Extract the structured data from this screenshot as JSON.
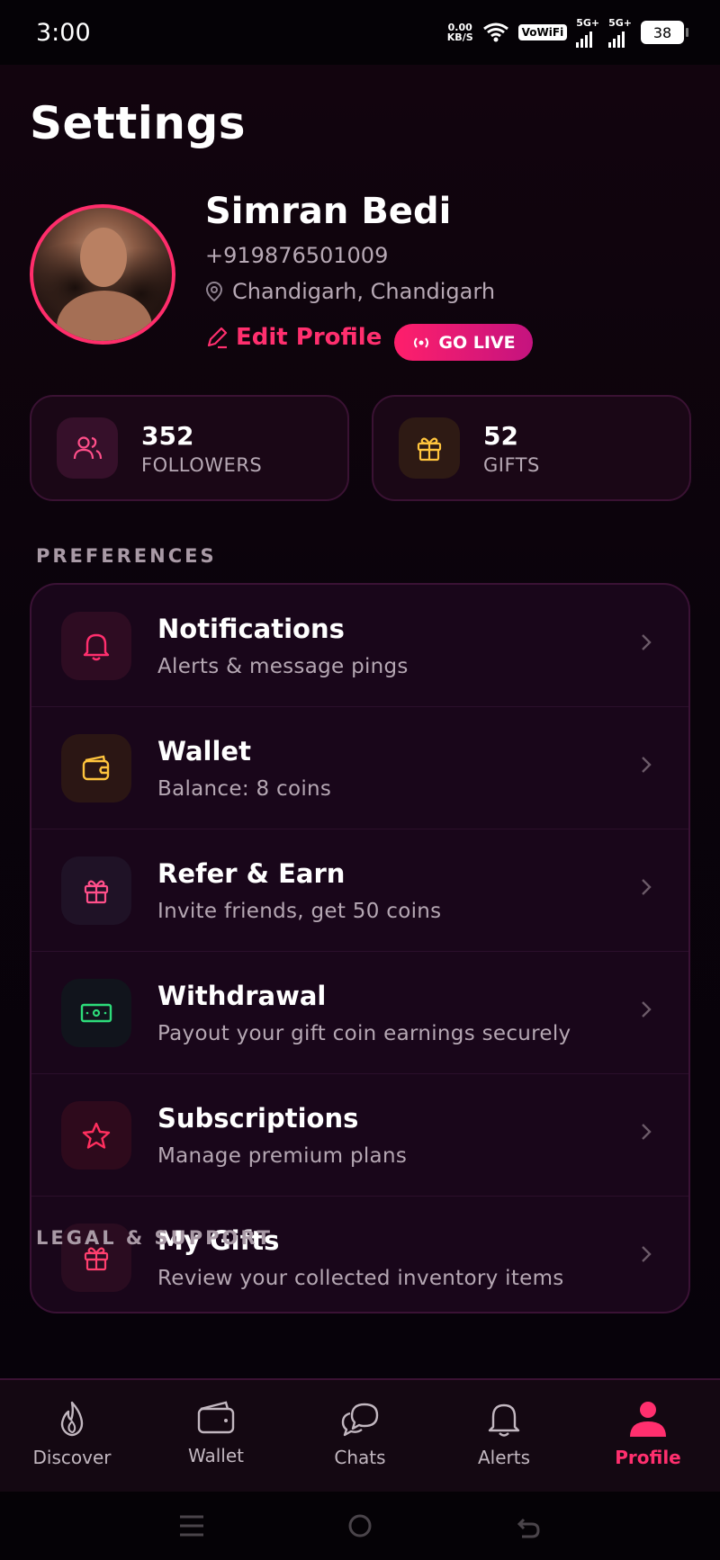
{
  "status_bar": {
    "time": "3:00",
    "net_speed_value": "0.00",
    "net_speed_unit": "KB/S",
    "vowifi": "VoWiFi",
    "sim1_label": "5G+",
    "sim2_label": "5G+",
    "battery": "38"
  },
  "header": {
    "title": "Settings"
  },
  "profile": {
    "name": "Simran Bedi",
    "phone": "+919876501009",
    "location": "Chandigarh, Chandigarh",
    "edit_label": "Edit Profile",
    "go_live_label": "GO LIVE"
  },
  "stats": [
    {
      "value": "352",
      "label": "FOLLOWERS",
      "icon": "users-icon"
    },
    {
      "value": "52",
      "label": "GIFTS",
      "icon": "gift-icon"
    }
  ],
  "preferences": {
    "section_title": "PREFERENCES",
    "items": [
      {
        "title": "Notifications",
        "subtitle": "Alerts & message pings",
        "icon": "bell-icon",
        "color": "#ff2f6e"
      },
      {
        "title": "Wallet",
        "subtitle": "Balance: 8 coins",
        "icon": "wallet-icon",
        "color": "#ffc43d"
      },
      {
        "title": "Refer & Earn",
        "subtitle": "Invite friends, get 50 coins",
        "icon": "gift-icon",
        "color": "#ff4f8a"
      },
      {
        "title": "Withdrawal",
        "subtitle": "Payout your gift coin earnings securely",
        "icon": "cash-icon",
        "color": "#2ddc7a"
      },
      {
        "title": "Subscriptions",
        "subtitle": "Manage premium plans",
        "icon": "star-icon",
        "color": "#ff2f5e"
      },
      {
        "title": "My Gifts",
        "subtitle": "Review your collected inventory items",
        "icon": "gift-icon",
        "color": "#ff3f6e"
      }
    ]
  },
  "legal": {
    "section_title": "LEGAL & SUPPORT"
  },
  "bottom_nav": {
    "items": [
      {
        "label": "Discover",
        "icon": "flame-icon"
      },
      {
        "label": "Wallet",
        "icon": "wallet-icon"
      },
      {
        "label": "Chats",
        "icon": "chat-icon"
      },
      {
        "label": "Alerts",
        "icon": "bell-icon"
      },
      {
        "label": "Profile",
        "icon": "person-icon",
        "active": true
      }
    ]
  },
  "colors": {
    "accent": "#ff2f6e",
    "gold": "#ffc43d",
    "green": "#2ddc7a",
    "background": "#0a030b"
  }
}
